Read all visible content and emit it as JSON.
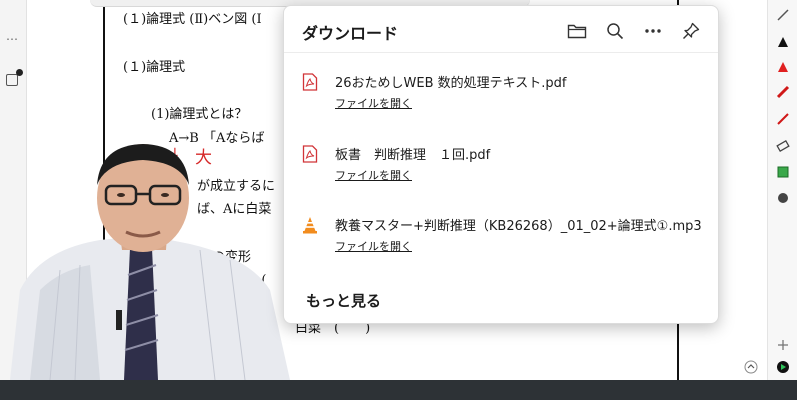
{
  "downloads": {
    "title": "ダウンロード",
    "actions": [
      {
        "name": "folder-icon"
      },
      {
        "name": "search-icon"
      },
      {
        "name": "more-icon"
      },
      {
        "name": "pin-icon"
      }
    ],
    "items": [
      {
        "filename": "26おためしWEB 数的処理テキスト.pdf",
        "open_label": "ファイルを開く",
        "icon": "pdf-icon"
      },
      {
        "filename": "板書　判断推理　１回.pdf",
        "open_label": "ファイルを開く",
        "icon": "pdf-icon"
      },
      {
        "filename": "教養マスター+判断推理（KB26268）_01_02+論理式①.mp3",
        "open_label": "ファイルを開く",
        "icon": "vlc-icon"
      }
    ],
    "more_label": "もっと見る"
  },
  "pdf": {
    "heading_top": "(１)論理式 (Ⅱ)ベン図 (Ⅰ",
    "heading_1": "(１)論理式",
    "sub_1": "(1)論理式とは？",
    "line_1": "A→B 「Aならば",
    "red_note": "大",
    "line_2": "が成立するに",
    "line_3": "ば、Aに白菜",
    "line_4": "式の変形",
    "line_5": "A　(",
    "line_6": "白菜　(　　)"
  }
}
